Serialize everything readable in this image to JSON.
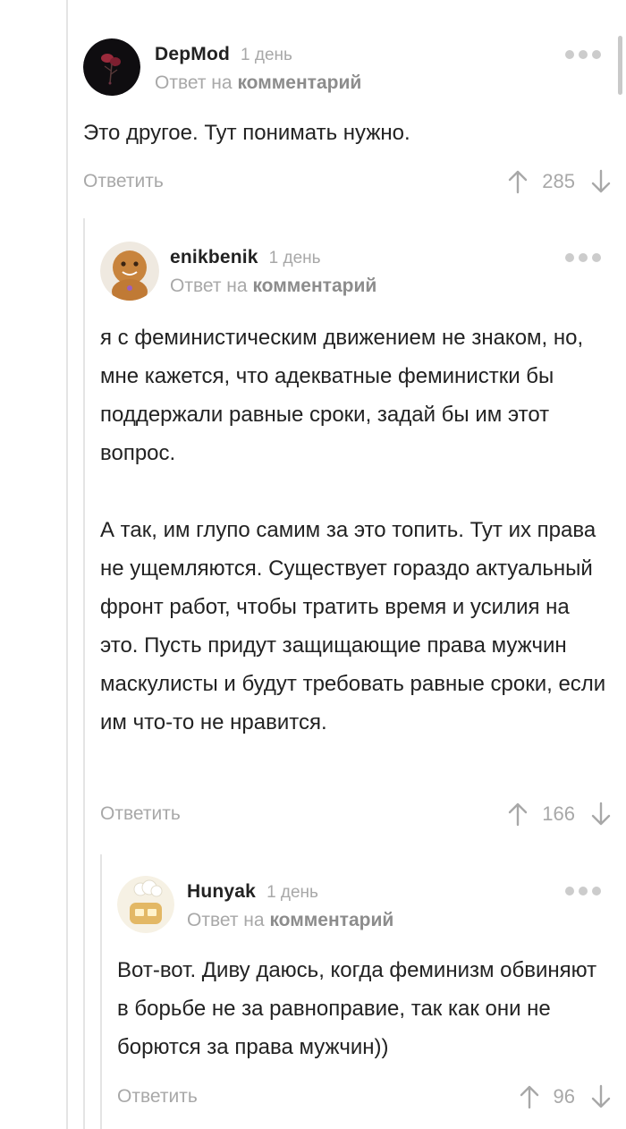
{
  "reply_to_prefix": "Ответ на",
  "reply_to_link": "комментарий",
  "reply_label": "Ответить",
  "colors": {
    "text": "#222222",
    "muted": "#a8a8a8",
    "thread_line": "#e4e4e4"
  },
  "comments": [
    {
      "author": "DepMod",
      "time": "1 день",
      "avatar_icon": "rose-avatar",
      "paragraphs": [
        "Это другое. Тут понимать нужно."
      ],
      "rating": "285"
    },
    {
      "author": "enikbenik",
      "time": "1 день",
      "avatar_icon": "gingerbread-avatar",
      "paragraphs": [
        "я с феминистическим движением не знаком, но, мне кажется, что адекватные феминистки бы поддержали равные сроки, задай бы им этот вопрос.",
        "А так, им глупо самим за это топить. Тут их права не ущемляются. Существует гораздо актуальный фронт работ, чтобы тратить время и усилия на это. Пусть придут защищающие права мужчин маскулисты и будут требовать равные сроки, если им что-то не нравится."
      ],
      "rating": "166"
    },
    {
      "author": "Hunyak",
      "time": "1 день",
      "avatar_icon": "baker-avatar",
      "paragraphs": [
        "Вот-вот. Диву даюсь, когда феминизм обвиняют в борьбе не за равноправие, так как они не борются за права мужчин))"
      ],
      "rating": "96"
    }
  ]
}
